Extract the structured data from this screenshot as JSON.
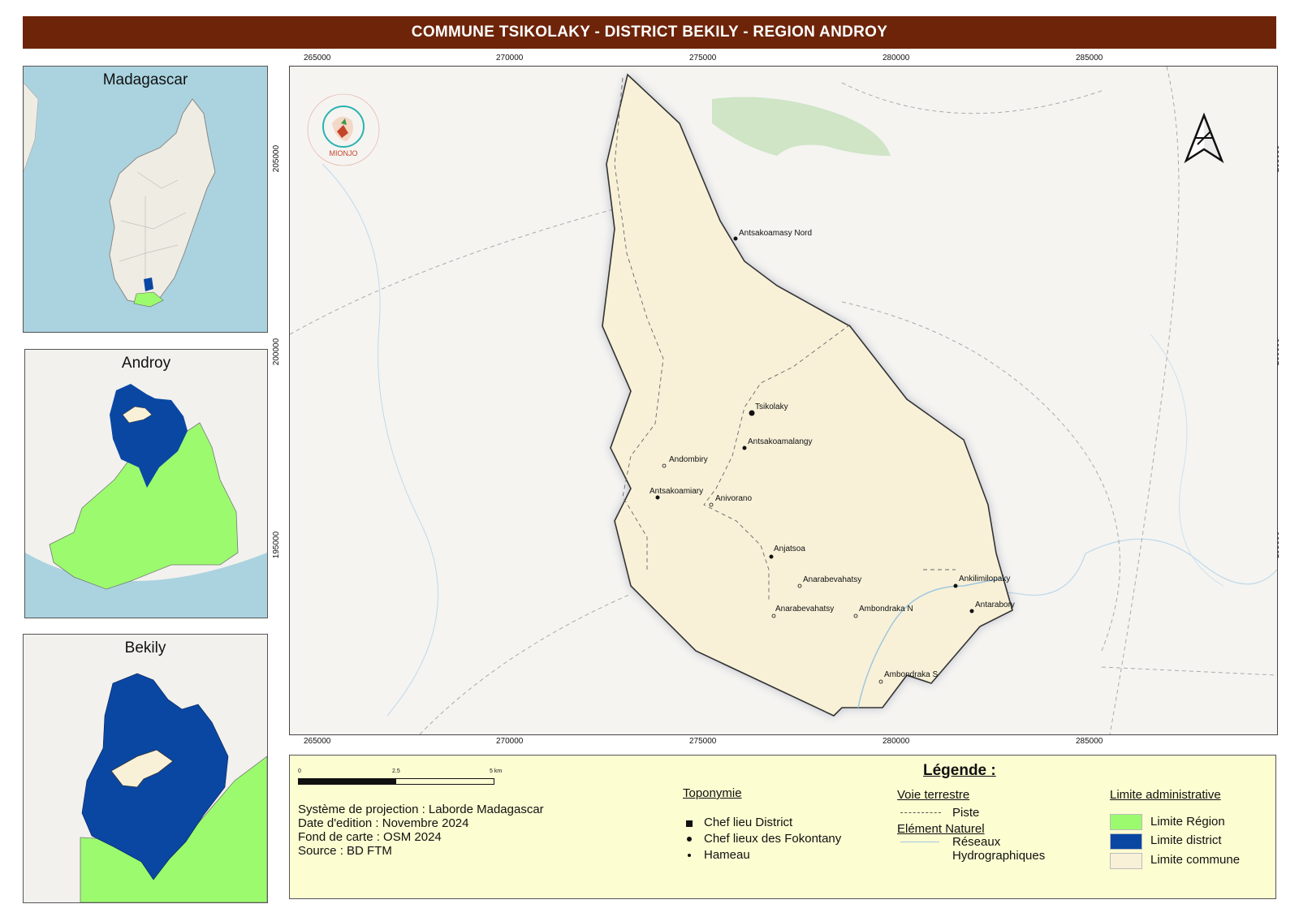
{
  "title": "COMMUNE TSIKOLAKY - DISTRICT BEKILY - REGION ANDROY",
  "insets": {
    "madagascar": "Madagascar",
    "androy": "Androy",
    "bekily": "Bekily"
  },
  "axes": {
    "x_ticks": [
      "265000",
      "270000",
      "275000",
      "280000",
      "285000"
    ],
    "y_ticks": [
      "205000",
      "200000",
      "195000"
    ]
  },
  "logo_text": "MIONJO",
  "places": [
    {
      "name": "Antsakoamasy Nord",
      "type": "fokontany"
    },
    {
      "name": "Tsikolaky",
      "type": "district"
    },
    {
      "name": "Antsakoamalangy",
      "type": "fokontany"
    },
    {
      "name": "Andombiry",
      "type": "hameau"
    },
    {
      "name": "Antsakoamiary",
      "type": "fokontany"
    },
    {
      "name": "Anivorano",
      "type": "hameau"
    },
    {
      "name": "Anjatsoa",
      "type": "fokontany"
    },
    {
      "name": "Anarabevahatsy",
      "type": "hameau"
    },
    {
      "name": "Anarabevahatsy",
      "type": "hameau"
    },
    {
      "name": "Ambondraka N",
      "type": "hameau"
    },
    {
      "name": "Ankilimilopaky",
      "type": "fokontany"
    },
    {
      "name": "Antarabory",
      "type": "fokontany"
    },
    {
      "name": "Ambondraka S",
      "type": "hameau"
    }
  ],
  "scale": {
    "labels": [
      "0",
      "2.5",
      "5 km"
    ]
  },
  "info": {
    "projection": "Système de projection : Laborde Madagascar",
    "date": "Date d'edition : Novembre 2024",
    "basemap": "Fond de carte : OSM 2024",
    "source": "Source : BD FTM"
  },
  "legend": {
    "title": "Légende :",
    "toponymie": "Toponymie",
    "chef_district": "Chef lieu District",
    "chef_fokontany": "Chef lieux des Fokontany",
    "hameau": "Hameau",
    "voie": "Voie terrestre",
    "piste": "Piste",
    "element_naturel": "Elément Naturel",
    "reseaux1": "Réseaux",
    "reseaux2": "Hydrographiques",
    "limite_admin": "Limite administrative",
    "limite_region": "Limite Région",
    "limite_district": "Limite district",
    "limite_commune": "Limite commune"
  },
  "colors": {
    "title_bar": "#6d2409",
    "region": "#9cfa6e",
    "district": "#0a47a3",
    "commune": "#f8f1d8",
    "sea": "#aad3df",
    "legend_bg": "#fdfdd2"
  }
}
